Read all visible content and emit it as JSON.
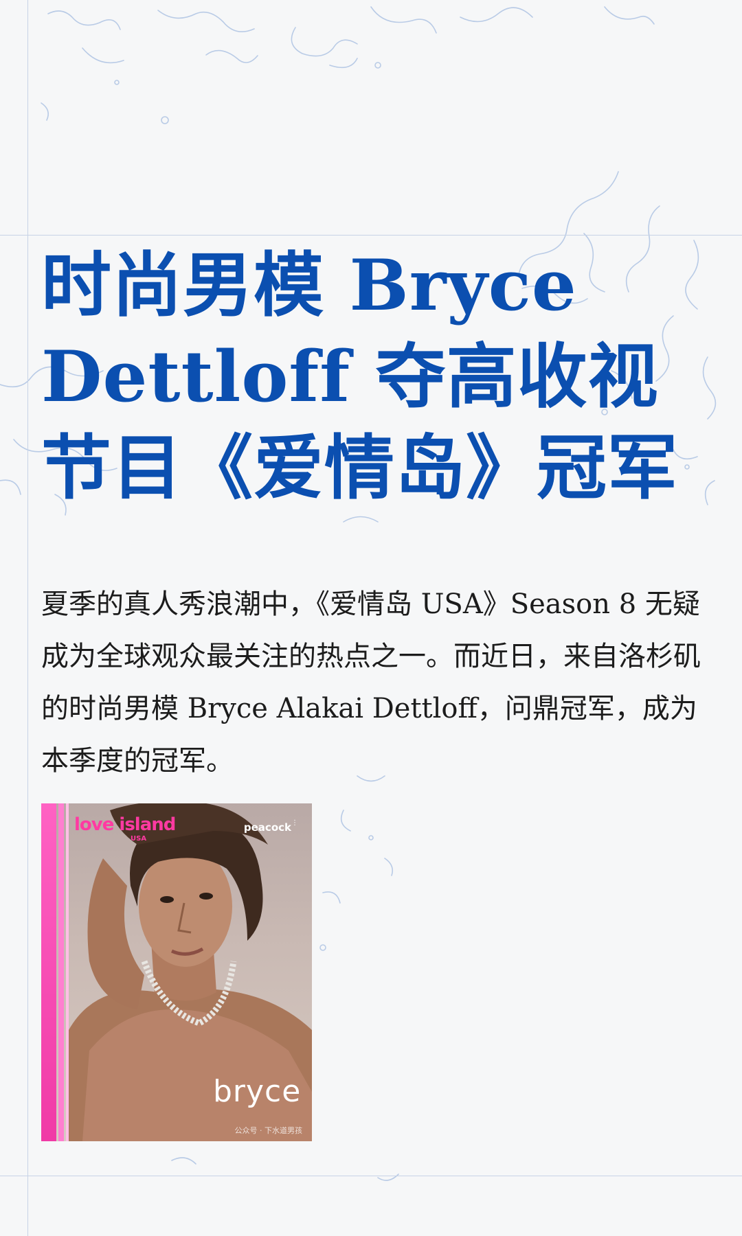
{
  "article": {
    "title": "时尚男模 Bryce Dettloff 夺高收视节目《爱情岛》冠军",
    "paragraph": "夏季的真人秀浪潮中，《爱情岛 USA》Season 8 无疑成为全球观众最关注的热点之一。而近日，来自洛杉矶的时尚男模 Bryce Alakai Dettloff，问鼎冠军，成为本季度的冠军。"
  },
  "cover_image": {
    "brand": "love island",
    "brand_sub": "USA",
    "network": "peacock",
    "name": "bryce",
    "watermark": "公众号 · 下水道男孩"
  },
  "colors": {
    "title": "#0b4fb0",
    "body_text": "#1c1c1c",
    "background": "#f6f7f8",
    "guide_lines": "#c7d3e6",
    "brand_pink": "#ff3aa2"
  }
}
